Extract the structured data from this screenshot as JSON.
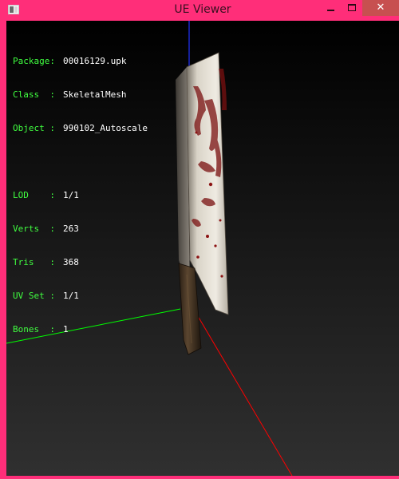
{
  "window": {
    "title": "UE Viewer",
    "icon": "ue-viewer-app-icon",
    "controls": {
      "minimize": "minimize-icon",
      "maximize": "maximize-icon",
      "close": "close-icon",
      "close_glyph": "✕"
    },
    "frame_color": "#ff2e79"
  },
  "info": {
    "object_info": [
      {
        "label": "Package:",
        "value": "00016129.upk"
      },
      {
        "label": "Class  :",
        "value": "SkeletalMesh"
      },
      {
        "label": "Object :",
        "value": "990102_Autoscale"
      }
    ],
    "mesh_info": [
      {
        "label": "LOD    :",
        "value": "1/1"
      },
      {
        "label": "Verts  :",
        "value": "263"
      },
      {
        "label": "Tris   :",
        "value": "368"
      },
      {
        "label": "UV Set :",
        "value": "1/1"
      },
      {
        "label": "Bones  :",
        "value": "1"
      }
    ],
    "label_color": "#40ff40",
    "value_color": "#ffffff"
  },
  "scene": {
    "axes": {
      "x_color": "#ff0000",
      "y_color": "#00ff00",
      "z_color": "#0000ff"
    },
    "model": "bloody-cleaver-mesh"
  }
}
